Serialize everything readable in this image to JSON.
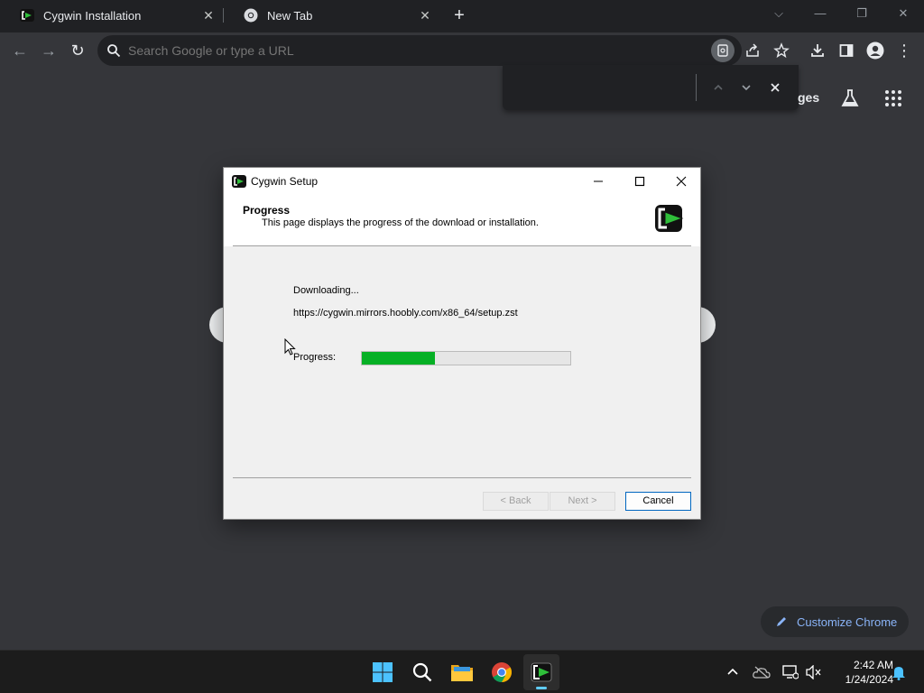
{
  "browser": {
    "tabs": [
      {
        "title": "Cygwin Installation",
        "active": true
      },
      {
        "title": "New Tab",
        "active": false
      }
    ],
    "new_tab_label": "+",
    "omnibox": {
      "placeholder": "Search Google or type a URL",
      "value": ""
    },
    "ntp": {
      "images_link_partial": "ges",
      "customize_label": "Customize Chrome"
    }
  },
  "dialog": {
    "title": "Cygwin Setup",
    "header_title": "Progress",
    "header_subtitle": "This page displays the progress of the download or installation.",
    "status_text": "Downloading...",
    "file_url": "https://cygwin.mirrors.hoobly.com/x86_64/setup.zst",
    "progress_label": "Progress:",
    "progress_fraction": 0.35,
    "buttons": {
      "back": "< Back",
      "next": "Next >",
      "cancel": "Cancel"
    }
  },
  "taskbar": {
    "clock_time": "2:42 AM",
    "clock_date": "1/24/2024"
  },
  "colors": {
    "progress_fill": "#06b025",
    "chrome_frame": "#202124",
    "ntp_background": "#35363a",
    "link_blue": "#8ab4f8"
  },
  "icons": {
    "tab1_favicon": "cygwin-icon",
    "tab2_favicon": "chrome-icon",
    "toolbar": [
      "back-icon",
      "forward-icon",
      "reload-icon",
      "search-icon",
      "find-in-page-icon",
      "share-icon",
      "star-icon",
      "download-icon",
      "side-panel-icon",
      "profile-icon",
      "menu-icon"
    ],
    "taskbar": [
      "windows-start-icon",
      "search-icon",
      "file-explorer-icon",
      "chrome-icon",
      "cygwin-terminal-icon"
    ]
  }
}
